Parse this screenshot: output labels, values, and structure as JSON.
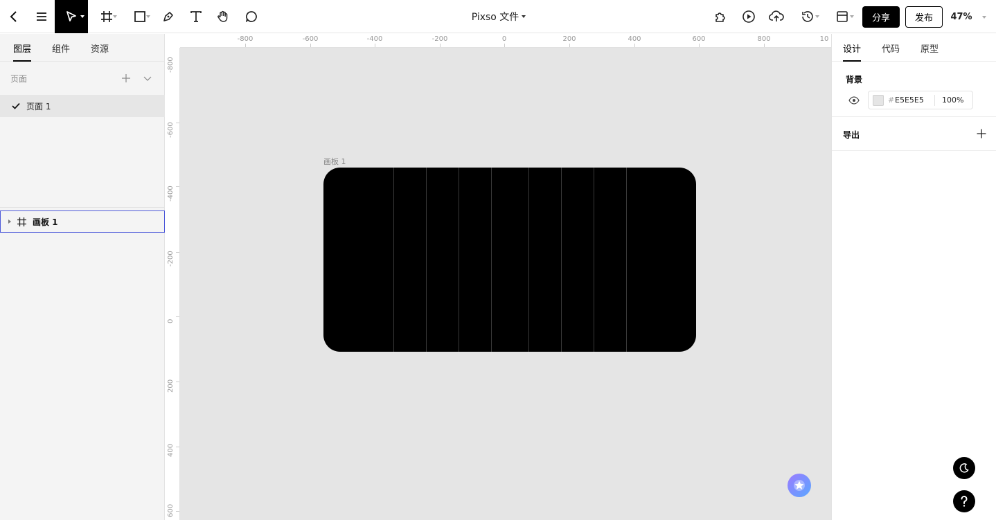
{
  "topbar": {
    "title": "Pixso 文件",
    "share_label": "分享",
    "publish_label": "发布",
    "zoom": "47%"
  },
  "left_panel": {
    "tabs": [
      {
        "label": "图层"
      },
      {
        "label": "组件"
      },
      {
        "label": "资源"
      }
    ],
    "pages_header": "页面",
    "pages": [
      {
        "label": "页面 1"
      }
    ],
    "layers": [
      {
        "label": "画板 1"
      }
    ]
  },
  "canvas": {
    "ruler_top": [
      "-800",
      "-600",
      "-400",
      "-200",
      "0",
      "200",
      "400",
      "600",
      "800",
      "10"
    ],
    "ruler_left": [
      "-800",
      "-600",
      "-400",
      "-200",
      "0",
      "200",
      "400",
      "600"
    ],
    "artboard_label": "画板 1",
    "background_color": "#E5E5E5"
  },
  "right_panel": {
    "tabs": [
      {
        "label": "设计"
      },
      {
        "label": "代码"
      },
      {
        "label": "原型"
      }
    ],
    "background_title": "背景",
    "bg_hash": "#",
    "bg_hex": "E5E5E5",
    "bg_opacity": "100",
    "bg_percent": "%",
    "export_title": "导出"
  }
}
